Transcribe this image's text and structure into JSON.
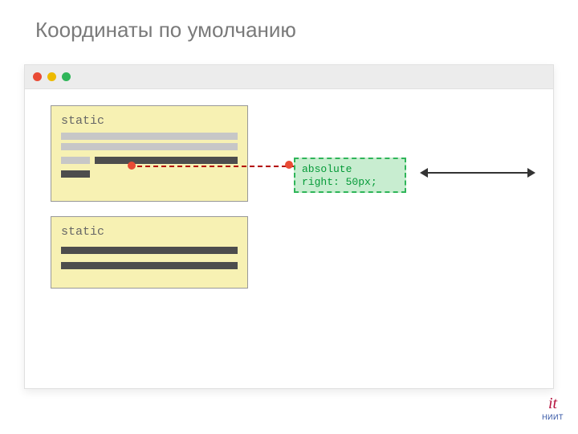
{
  "title": "Координаты по умолчанию",
  "block1_label": "static",
  "block2_label": "static",
  "absolute_box": {
    "line1": "absolute",
    "line2": "right: 50px;"
  },
  "logo": {
    "icon": "it",
    "text": "НИИТ"
  }
}
